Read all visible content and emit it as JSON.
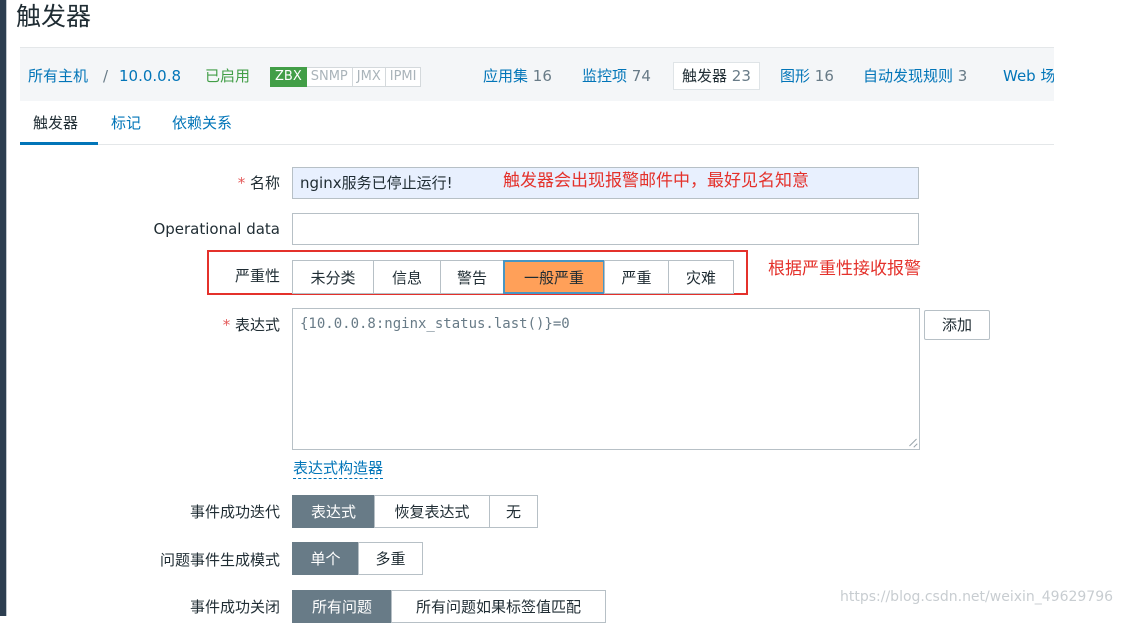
{
  "page": {
    "title": "触发器"
  },
  "hostbar": {
    "all_hosts": "所有主机",
    "separator": "/",
    "host": "10.0.0.8",
    "enabled": "已启用",
    "availability": [
      "ZBX",
      "SNMP",
      "JMX",
      "IPMI"
    ],
    "links": [
      {
        "label": "应用集",
        "count": "16"
      },
      {
        "label": "监控项",
        "count": "74"
      },
      {
        "label": "触发器",
        "count": "23",
        "active": true
      },
      {
        "label": "图形",
        "count": "16"
      },
      {
        "label": "自动发现规则",
        "count": "3"
      },
      {
        "label": "Web 场",
        "count": ""
      }
    ]
  },
  "tabs": [
    {
      "label": "触发器",
      "active": true
    },
    {
      "label": "标记"
    },
    {
      "label": "依赖关系"
    }
  ],
  "form": {
    "name": {
      "label": "名称",
      "value": "nginx服务已停止运行!",
      "annotation": "触发器会出现报警邮件中，最好见名知意"
    },
    "operational_data": {
      "label": "Operational data",
      "value": ""
    },
    "severity": {
      "label": "严重性",
      "options": [
        "未分类",
        "信息",
        "警告",
        "一般严重",
        "严重",
        "灾难"
      ],
      "selected": "一般严重",
      "annotation": "根据严重性接收报警"
    },
    "expression": {
      "label": "表达式",
      "value": "{10.0.0.8:nginx_status.last()}=0",
      "add_button": "添加",
      "builder_link": "表达式构造器"
    },
    "ok_event_generation": {
      "label": "事件成功迭代",
      "options": [
        "表达式",
        "恢复表达式",
        "无"
      ],
      "selected": "表达式"
    },
    "problem_mode": {
      "label": "问题事件生成模式",
      "options": [
        "单个",
        "多重"
      ],
      "selected": "单个"
    },
    "ok_event_closes": {
      "label": "事件成功关闭",
      "options": [
        "所有问题",
        "所有问题如果标签值匹配"
      ],
      "selected": "所有问题"
    }
  },
  "watermark": "https://blog.csdn.net/weixin_49629796",
  "colors": {
    "link": "#0275b8",
    "enabled": "#429e47",
    "severity_selected": "#ffa059",
    "segment_selected": "#687b87",
    "annotation": "#e4312b"
  }
}
